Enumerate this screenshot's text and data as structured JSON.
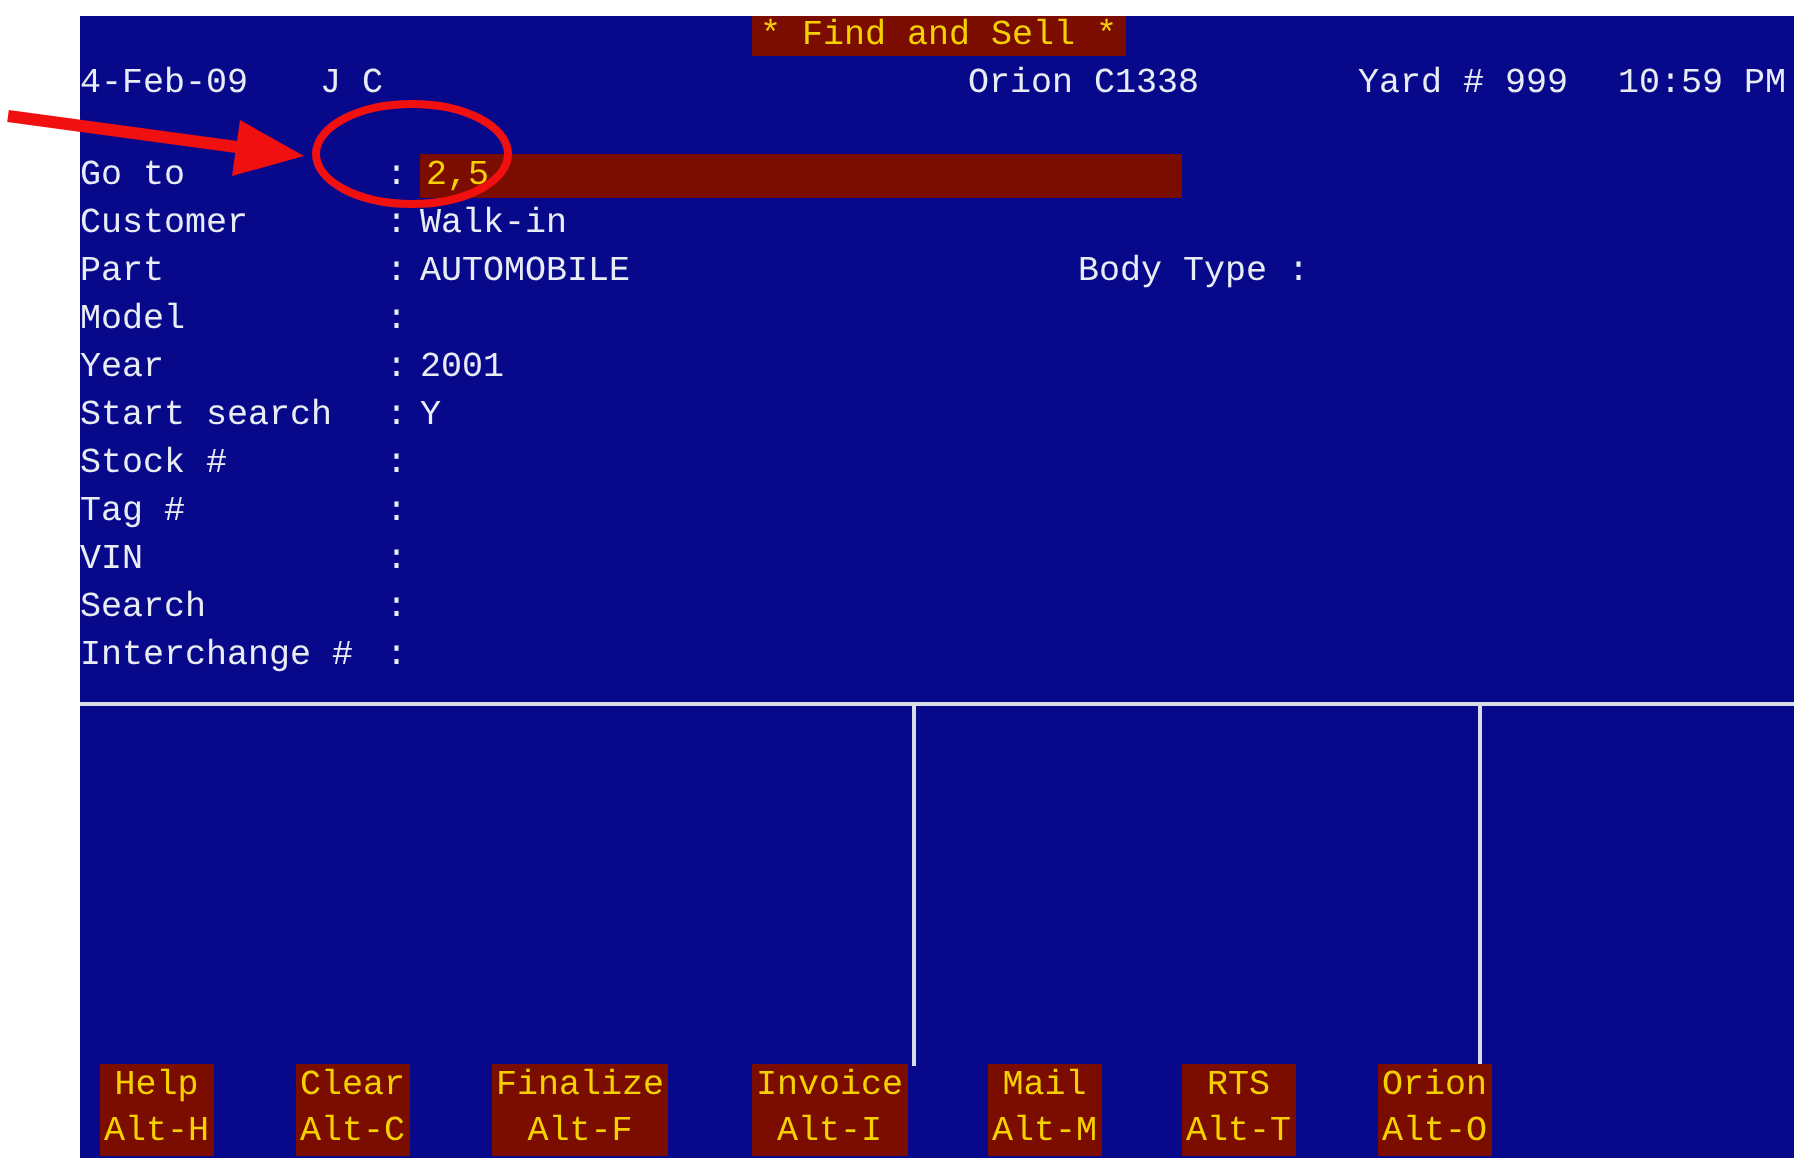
{
  "title": "* Find and Sell *",
  "header": {
    "date": "4-Feb-09",
    "user": "J C",
    "system": "Orion C1338",
    "yard": "Yard # 999",
    "time": "10:59 PM"
  },
  "fields": [
    {
      "label": "Go to",
      "separator": ":",
      "value": "2,5",
      "kind": "input"
    },
    {
      "label": "Customer",
      "separator": ":",
      "value": "Walk-in",
      "kind": "text"
    },
    {
      "label": "Part",
      "separator": ":",
      "value": "AUTOMOBILE",
      "kind": "text"
    },
    {
      "label": "Model",
      "separator": ":",
      "kind": "text"
    },
    {
      "label": "Year",
      "separator": ":",
      "value": "2001",
      "kind": "text"
    },
    {
      "label": "Start search",
      "separator": ":",
      "value": "Y",
      "kind": "text"
    },
    {
      "label": "Stock #",
      "separator": ":",
      "kind": "text"
    },
    {
      "label": "Tag #",
      "separator": ":",
      "kind": "text"
    },
    {
      "label": "VIN",
      "separator": ":",
      "kind": "text"
    },
    {
      "label": "Search",
      "separator": ":",
      "kind": "text"
    },
    {
      "label": "Interchange #",
      "separator": ":",
      "kind": "text"
    }
  ],
  "body_type": {
    "label": "Body Type :"
  },
  "function_keys": [
    {
      "label": "Help",
      "shortcut": "Alt-H"
    },
    {
      "label": "Clear",
      "shortcut": "Alt-C"
    },
    {
      "label": "Finalize",
      "shortcut": "Alt-F"
    },
    {
      "label": "Invoice",
      "shortcut": "Alt-I"
    },
    {
      "label": "Mail",
      "shortcut": "Alt-M"
    },
    {
      "label": "RTS",
      "shortcut": "Alt-T"
    },
    {
      "label": "Orion",
      "shortcut": "Alt-O"
    }
  ]
}
